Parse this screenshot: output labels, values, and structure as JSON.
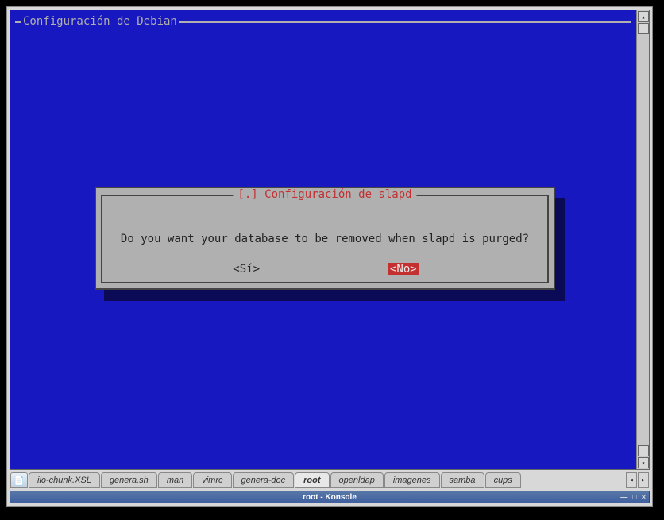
{
  "terminal": {
    "frame_title": "Configuración de Debian"
  },
  "dialog": {
    "title": "[.] Configuración de slapd",
    "question": "Do you want your database to be removed when slapd is purged?",
    "yes_label": "<Sí>",
    "no_label": "<No>"
  },
  "tabs": {
    "items": [
      "ilo-chunk.XSL",
      "genera.sh",
      "man",
      "vimrc",
      "genera-doc",
      "root",
      "openldap",
      "imagenes",
      "samba",
      "cups"
    ],
    "active_index": 5
  },
  "statusbar": {
    "title": "root - Konsole"
  },
  "icons": {
    "scroll_up": "▴",
    "scroll_down": "▾",
    "tab_left": "◂",
    "tab_right": "▸",
    "new_tab": "📄",
    "minimize": "—",
    "maximize": "□",
    "close": "×"
  }
}
